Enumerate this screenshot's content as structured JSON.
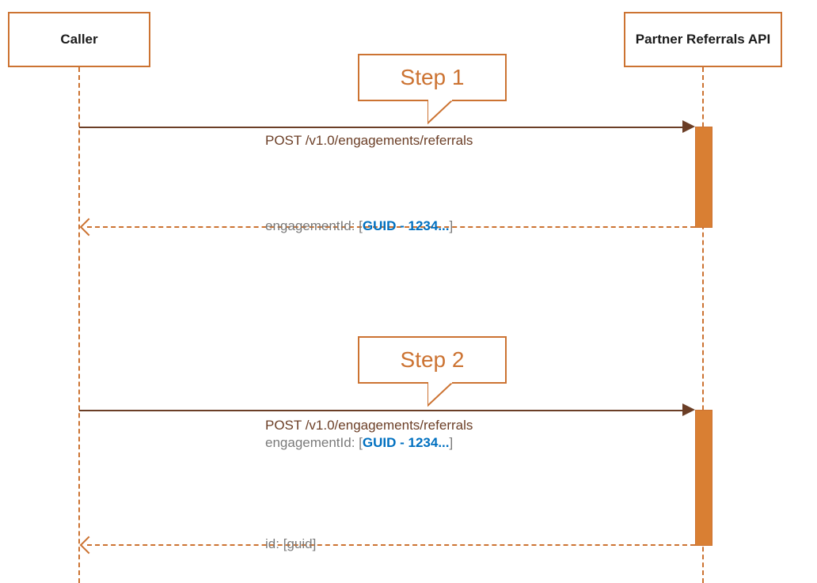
{
  "participants": {
    "caller": "Caller",
    "api": "Partner Referrals API"
  },
  "callouts": {
    "step1": "Step 1",
    "step2": "Step 2"
  },
  "messages": {
    "step1_request": "POST /v1.0/engagements/referrals",
    "step1_response_key": "engagementId: ",
    "step1_response_guid": "GUID - 1234...",
    "step2_request_line1": "POST /v1.0/engagements/referrals",
    "step2_request_line2_key": "engagementId: ",
    "step2_request_line2_guid": "GUID - 1234...",
    "step2_response_key": "id: ",
    "step2_response_val": "guid"
  },
  "colors": {
    "border": "#CC7332",
    "fill": "#D97F33",
    "line": "#6B3E26",
    "blue": "#0070C0",
    "gray": "#7A7A7A"
  }
}
